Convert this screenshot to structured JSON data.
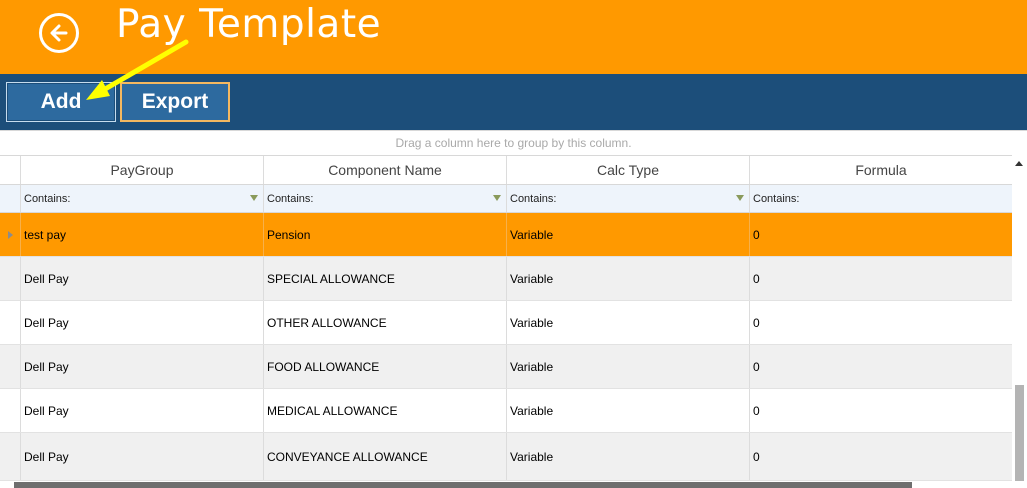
{
  "header": {
    "title": "Pay Template",
    "back_icon": "back-arrow-circle-icon"
  },
  "toolbar": {
    "add_label": "Add",
    "export_label": "Export"
  },
  "grid": {
    "group_hint": "Drag a column here to group by this column.",
    "columns": [
      "PayGroup",
      "Component Name",
      "Calc Type",
      "Formula"
    ],
    "filter_label": "Contains:",
    "rows": [
      {
        "paygroup": "test pay",
        "component": "Pension",
        "calc_type": "Variable",
        "formula": "0",
        "selected": true
      },
      {
        "paygroup": "Dell Pay",
        "component": "SPECIAL ALLOWANCE",
        "calc_type": "Variable",
        "formula": "0"
      },
      {
        "paygroup": "Dell Pay",
        "component": "OTHER ALLOWANCE",
        "calc_type": "Variable",
        "formula": "0"
      },
      {
        "paygroup": "Dell Pay",
        "component": "FOOD ALLOWANCE",
        "calc_type": "Variable",
        "formula": "0"
      },
      {
        "paygroup": "Dell Pay",
        "component": "MEDICAL ALLOWANCE",
        "calc_type": "Variable",
        "formula": "0"
      },
      {
        "paygroup": "Dell Pay",
        "component": "CONVEYANCE ALLOWANCE",
        "calc_type": "Variable",
        "formula": "0"
      }
    ]
  },
  "colors": {
    "header_bg": "#ff9900",
    "toolbar_bg": "#1c4e7a",
    "button_bg": "#2d6a9f",
    "selected_row": "#ff9900",
    "annotation_arrow": "#ffff00"
  }
}
